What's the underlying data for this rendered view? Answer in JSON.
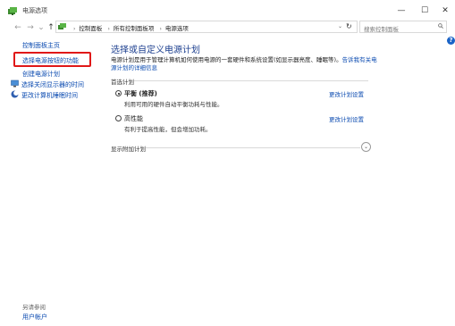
{
  "window": {
    "title": "电源选项",
    "minimize": "—",
    "maximize": "☐",
    "close": "✕"
  },
  "address_bar": {
    "back": "←",
    "forward": "→",
    "recent": "⌄",
    "up": "↑",
    "crumbs": [
      "控制面板",
      "所有控制面板项",
      "电源选项"
    ],
    "dropdown": "⌄",
    "refresh": "↻"
  },
  "search": {
    "placeholder": "搜索控制面板"
  },
  "help": "?",
  "sidebar": {
    "home": "控制面板主页",
    "items": [
      "选择电源按钮的功能",
      "创建电源计划",
      "选择关闭显示器的时间",
      "更改计算机睡眠时间"
    ],
    "see_also": "另请参阅",
    "user_accounts": "用户帐户"
  },
  "main": {
    "heading": "选择或自定义电源计划",
    "desc_line1": "电源计划是用于管理计算机如何使用电源的一套硬件和系统设置(如显示器亮度、睡眠等)。",
    "desc_link": "告诉我有关电源计划的详细信息",
    "preferred_label": "首选计划",
    "plans": [
      {
        "name": "平衡 (推荐)",
        "desc": "利用可用的硬件自动平衡功耗与性能。",
        "link": "更改计划设置",
        "selected": true
      },
      {
        "name": "高性能",
        "desc": "有利于提高性能，但会增加功耗。",
        "link": "更改计划设置",
        "selected": false
      }
    ],
    "more_label": "显示附加计划",
    "expand_icon": "⌄"
  }
}
